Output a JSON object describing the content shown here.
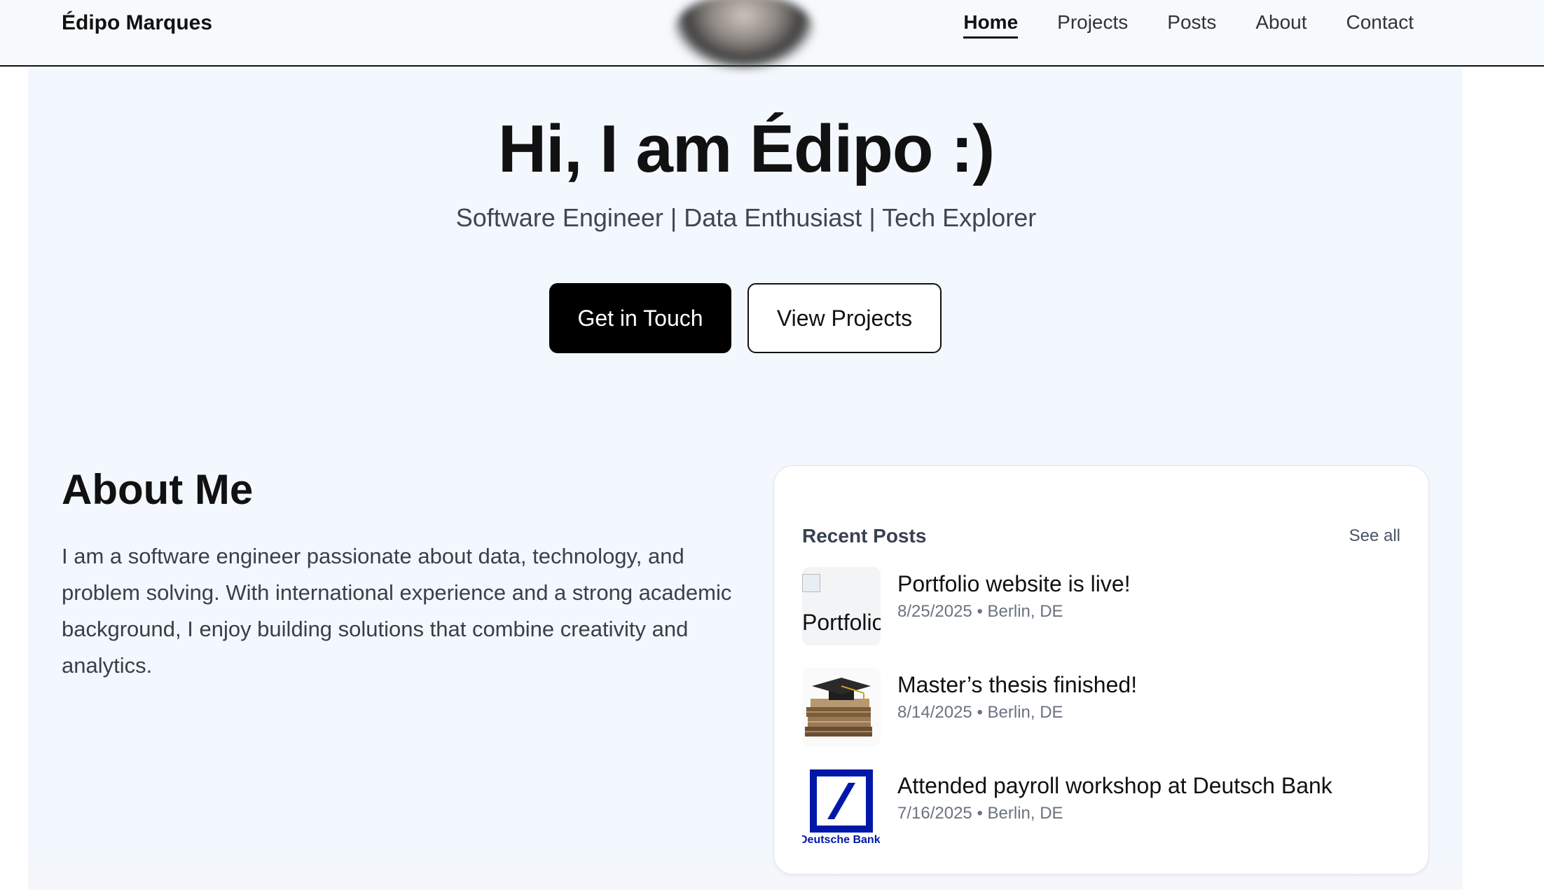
{
  "header": {
    "brand": "Édipo Marques",
    "nav": [
      {
        "label": "Home",
        "active": true
      },
      {
        "label": "Projects"
      },
      {
        "label": "Posts"
      },
      {
        "label": "About"
      },
      {
        "label": "Contact"
      }
    ]
  },
  "hero": {
    "title": "Hi, I am Édipo :)",
    "subtitle": "Software Engineer | Data Enthusiast | Tech Explorer",
    "primary_button": "Get in Touch",
    "secondary_button": "View Projects"
  },
  "about": {
    "title": "About Me",
    "text": "I am a software engineer passionate about data, technology, and problem solving. With international experience and a strong academic background, I enjoy building solutions that combine creativity and analytics."
  },
  "recent_posts": {
    "title": "Recent Posts",
    "see_all": "See all",
    "posts": [
      {
        "title": "Portfolio website is live!",
        "meta": "8/25/2025 • Berlin, DE",
        "thumb_alt": "Portfolio website",
        "thumb": "broken-image-icon"
      },
      {
        "title": "Master’s thesis finished!",
        "meta": "8/14/2025 • Berlin, DE",
        "thumb": "graduation-cap-books-image"
      },
      {
        "title": "Attended payroll workshop at Deutsch Bank",
        "meta": "7/16/2025 • Berlin, DE",
        "thumb": "deutsche-bank-logo",
        "thumb_text": "Deutsche Bank"
      }
    ]
  },
  "colors": {
    "page_background": "#f3f8fe",
    "primary_button": "#000000",
    "deutsche_bank_blue": "#0018a8"
  }
}
